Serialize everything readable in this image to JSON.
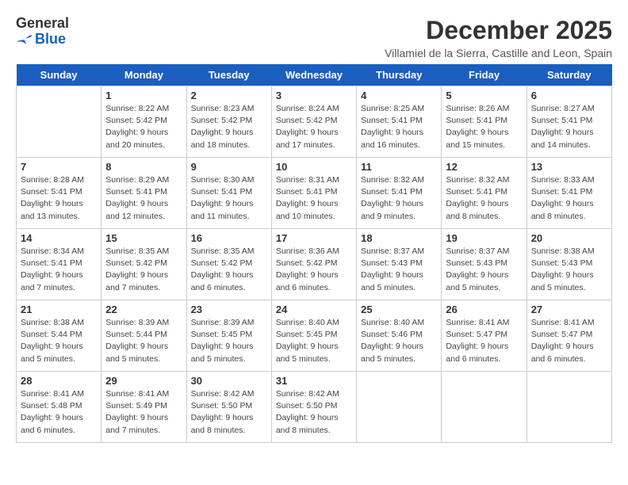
{
  "header": {
    "logo": {
      "general": "General",
      "blue": "Blue"
    },
    "title": "December 2025",
    "location": "Villamiel de la Sierra, Castille and Leon, Spain"
  },
  "days": [
    "Sunday",
    "Monday",
    "Tuesday",
    "Wednesday",
    "Thursday",
    "Friday",
    "Saturday"
  ],
  "weeks": [
    [
      {
        "date": "",
        "info": ""
      },
      {
        "date": "1",
        "info": "Sunrise: 8:22 AM\nSunset: 5:42 PM\nDaylight: 9 hours\nand 20 minutes."
      },
      {
        "date": "2",
        "info": "Sunrise: 8:23 AM\nSunset: 5:42 PM\nDaylight: 9 hours\nand 18 minutes."
      },
      {
        "date": "3",
        "info": "Sunrise: 8:24 AM\nSunset: 5:42 PM\nDaylight: 9 hours\nand 17 minutes."
      },
      {
        "date": "4",
        "info": "Sunrise: 8:25 AM\nSunset: 5:41 PM\nDaylight: 9 hours\nand 16 minutes."
      },
      {
        "date": "5",
        "info": "Sunrise: 8:26 AM\nSunset: 5:41 PM\nDaylight: 9 hours\nand 15 minutes."
      },
      {
        "date": "6",
        "info": "Sunrise: 8:27 AM\nSunset: 5:41 PM\nDaylight: 9 hours\nand 14 minutes."
      }
    ],
    [
      {
        "date": "7",
        "info": "Sunrise: 8:28 AM\nSunset: 5:41 PM\nDaylight: 9 hours\nand 13 minutes."
      },
      {
        "date": "8",
        "info": "Sunrise: 8:29 AM\nSunset: 5:41 PM\nDaylight: 9 hours\nand 12 minutes."
      },
      {
        "date": "9",
        "info": "Sunrise: 8:30 AM\nSunset: 5:41 PM\nDaylight: 9 hours\nand 11 minutes."
      },
      {
        "date": "10",
        "info": "Sunrise: 8:31 AM\nSunset: 5:41 PM\nDaylight: 9 hours\nand 10 minutes."
      },
      {
        "date": "11",
        "info": "Sunrise: 8:32 AM\nSunset: 5:41 PM\nDaylight: 9 hours\nand 9 minutes."
      },
      {
        "date": "12",
        "info": "Sunrise: 8:32 AM\nSunset: 5:41 PM\nDaylight: 9 hours\nand 8 minutes."
      },
      {
        "date": "13",
        "info": "Sunrise: 8:33 AM\nSunset: 5:41 PM\nDaylight: 9 hours\nand 8 minutes."
      }
    ],
    [
      {
        "date": "14",
        "info": "Sunrise: 8:34 AM\nSunset: 5:41 PM\nDaylight: 9 hours\nand 7 minutes."
      },
      {
        "date": "15",
        "info": "Sunrise: 8:35 AM\nSunset: 5:42 PM\nDaylight: 9 hours\nand 7 minutes."
      },
      {
        "date": "16",
        "info": "Sunrise: 8:35 AM\nSunset: 5:42 PM\nDaylight: 9 hours\nand 6 minutes."
      },
      {
        "date": "17",
        "info": "Sunrise: 8:36 AM\nSunset: 5:42 PM\nDaylight: 9 hours\nand 6 minutes."
      },
      {
        "date": "18",
        "info": "Sunrise: 8:37 AM\nSunset: 5:43 PM\nDaylight: 9 hours\nand 5 minutes."
      },
      {
        "date": "19",
        "info": "Sunrise: 8:37 AM\nSunset: 5:43 PM\nDaylight: 9 hours\nand 5 minutes."
      },
      {
        "date": "20",
        "info": "Sunrise: 8:38 AM\nSunset: 5:43 PM\nDaylight: 9 hours\nand 5 minutes."
      }
    ],
    [
      {
        "date": "21",
        "info": "Sunrise: 8:38 AM\nSunset: 5:44 PM\nDaylight: 9 hours\nand 5 minutes."
      },
      {
        "date": "22",
        "info": "Sunrise: 8:39 AM\nSunset: 5:44 PM\nDaylight: 9 hours\nand 5 minutes."
      },
      {
        "date": "23",
        "info": "Sunrise: 8:39 AM\nSunset: 5:45 PM\nDaylight: 9 hours\nand 5 minutes."
      },
      {
        "date": "24",
        "info": "Sunrise: 8:40 AM\nSunset: 5:45 PM\nDaylight: 9 hours\nand 5 minutes."
      },
      {
        "date": "25",
        "info": "Sunrise: 8:40 AM\nSunset: 5:46 PM\nDaylight: 9 hours\nand 5 minutes."
      },
      {
        "date": "26",
        "info": "Sunrise: 8:41 AM\nSunset: 5:47 PM\nDaylight: 9 hours\nand 6 minutes."
      },
      {
        "date": "27",
        "info": "Sunrise: 8:41 AM\nSunset: 5:47 PM\nDaylight: 9 hours\nand 6 minutes."
      }
    ],
    [
      {
        "date": "28",
        "info": "Sunrise: 8:41 AM\nSunset: 5:48 PM\nDaylight: 9 hours\nand 6 minutes."
      },
      {
        "date": "29",
        "info": "Sunrise: 8:41 AM\nSunset: 5:49 PM\nDaylight: 9 hours\nand 7 minutes."
      },
      {
        "date": "30",
        "info": "Sunrise: 8:42 AM\nSunset: 5:50 PM\nDaylight: 9 hours\nand 8 minutes."
      },
      {
        "date": "31",
        "info": "Sunrise: 8:42 AM\nSunset: 5:50 PM\nDaylight: 9 hours\nand 8 minutes."
      },
      {
        "date": "",
        "info": ""
      },
      {
        "date": "",
        "info": ""
      },
      {
        "date": "",
        "info": ""
      }
    ]
  ]
}
